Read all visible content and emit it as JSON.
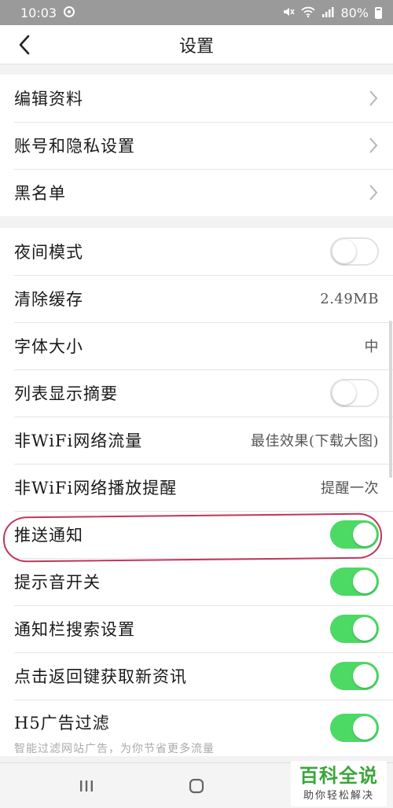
{
  "status_bar": {
    "time": "10:03",
    "battery": "80%"
  },
  "header": {
    "title": "设置"
  },
  "group1": {
    "items": [
      {
        "label": "编辑资料"
      },
      {
        "label": "账号和隐私设置"
      },
      {
        "label": "黑名单"
      }
    ]
  },
  "group2": {
    "night_mode": {
      "label": "夜间模式",
      "on": false
    },
    "clear_cache": {
      "label": "清除缓存",
      "value": "2.49MB"
    },
    "font_size": {
      "label": "字体大小",
      "value": "中"
    },
    "list_summary": {
      "label": "列表显示摘要",
      "on": false
    },
    "non_wifi_traffic": {
      "label": "非WiFi网络流量",
      "value": "最佳效果(下载大图)"
    },
    "non_wifi_play": {
      "label": "非WiFi网络播放提醒",
      "value": "提醒一次"
    },
    "push": {
      "label": "推送通知",
      "on": true
    },
    "sound": {
      "label": "提示音开关",
      "on": true
    },
    "notif_search": {
      "label": "通知栏搜索设置",
      "on": true
    },
    "back_refresh": {
      "label": "点击返回键获取新资讯",
      "on": true
    },
    "h5_filter": {
      "label": "H5广告过滤",
      "sub": "智能过滤网站广告，为你节省更多流量",
      "on": true
    }
  },
  "watermark": {
    "main": "百科全说",
    "sub": "助你轻松解决"
  },
  "colors": {
    "toggle_on": "#4cd964",
    "annotation": "#c0365a",
    "status_bar": "#9a9a9a"
  }
}
